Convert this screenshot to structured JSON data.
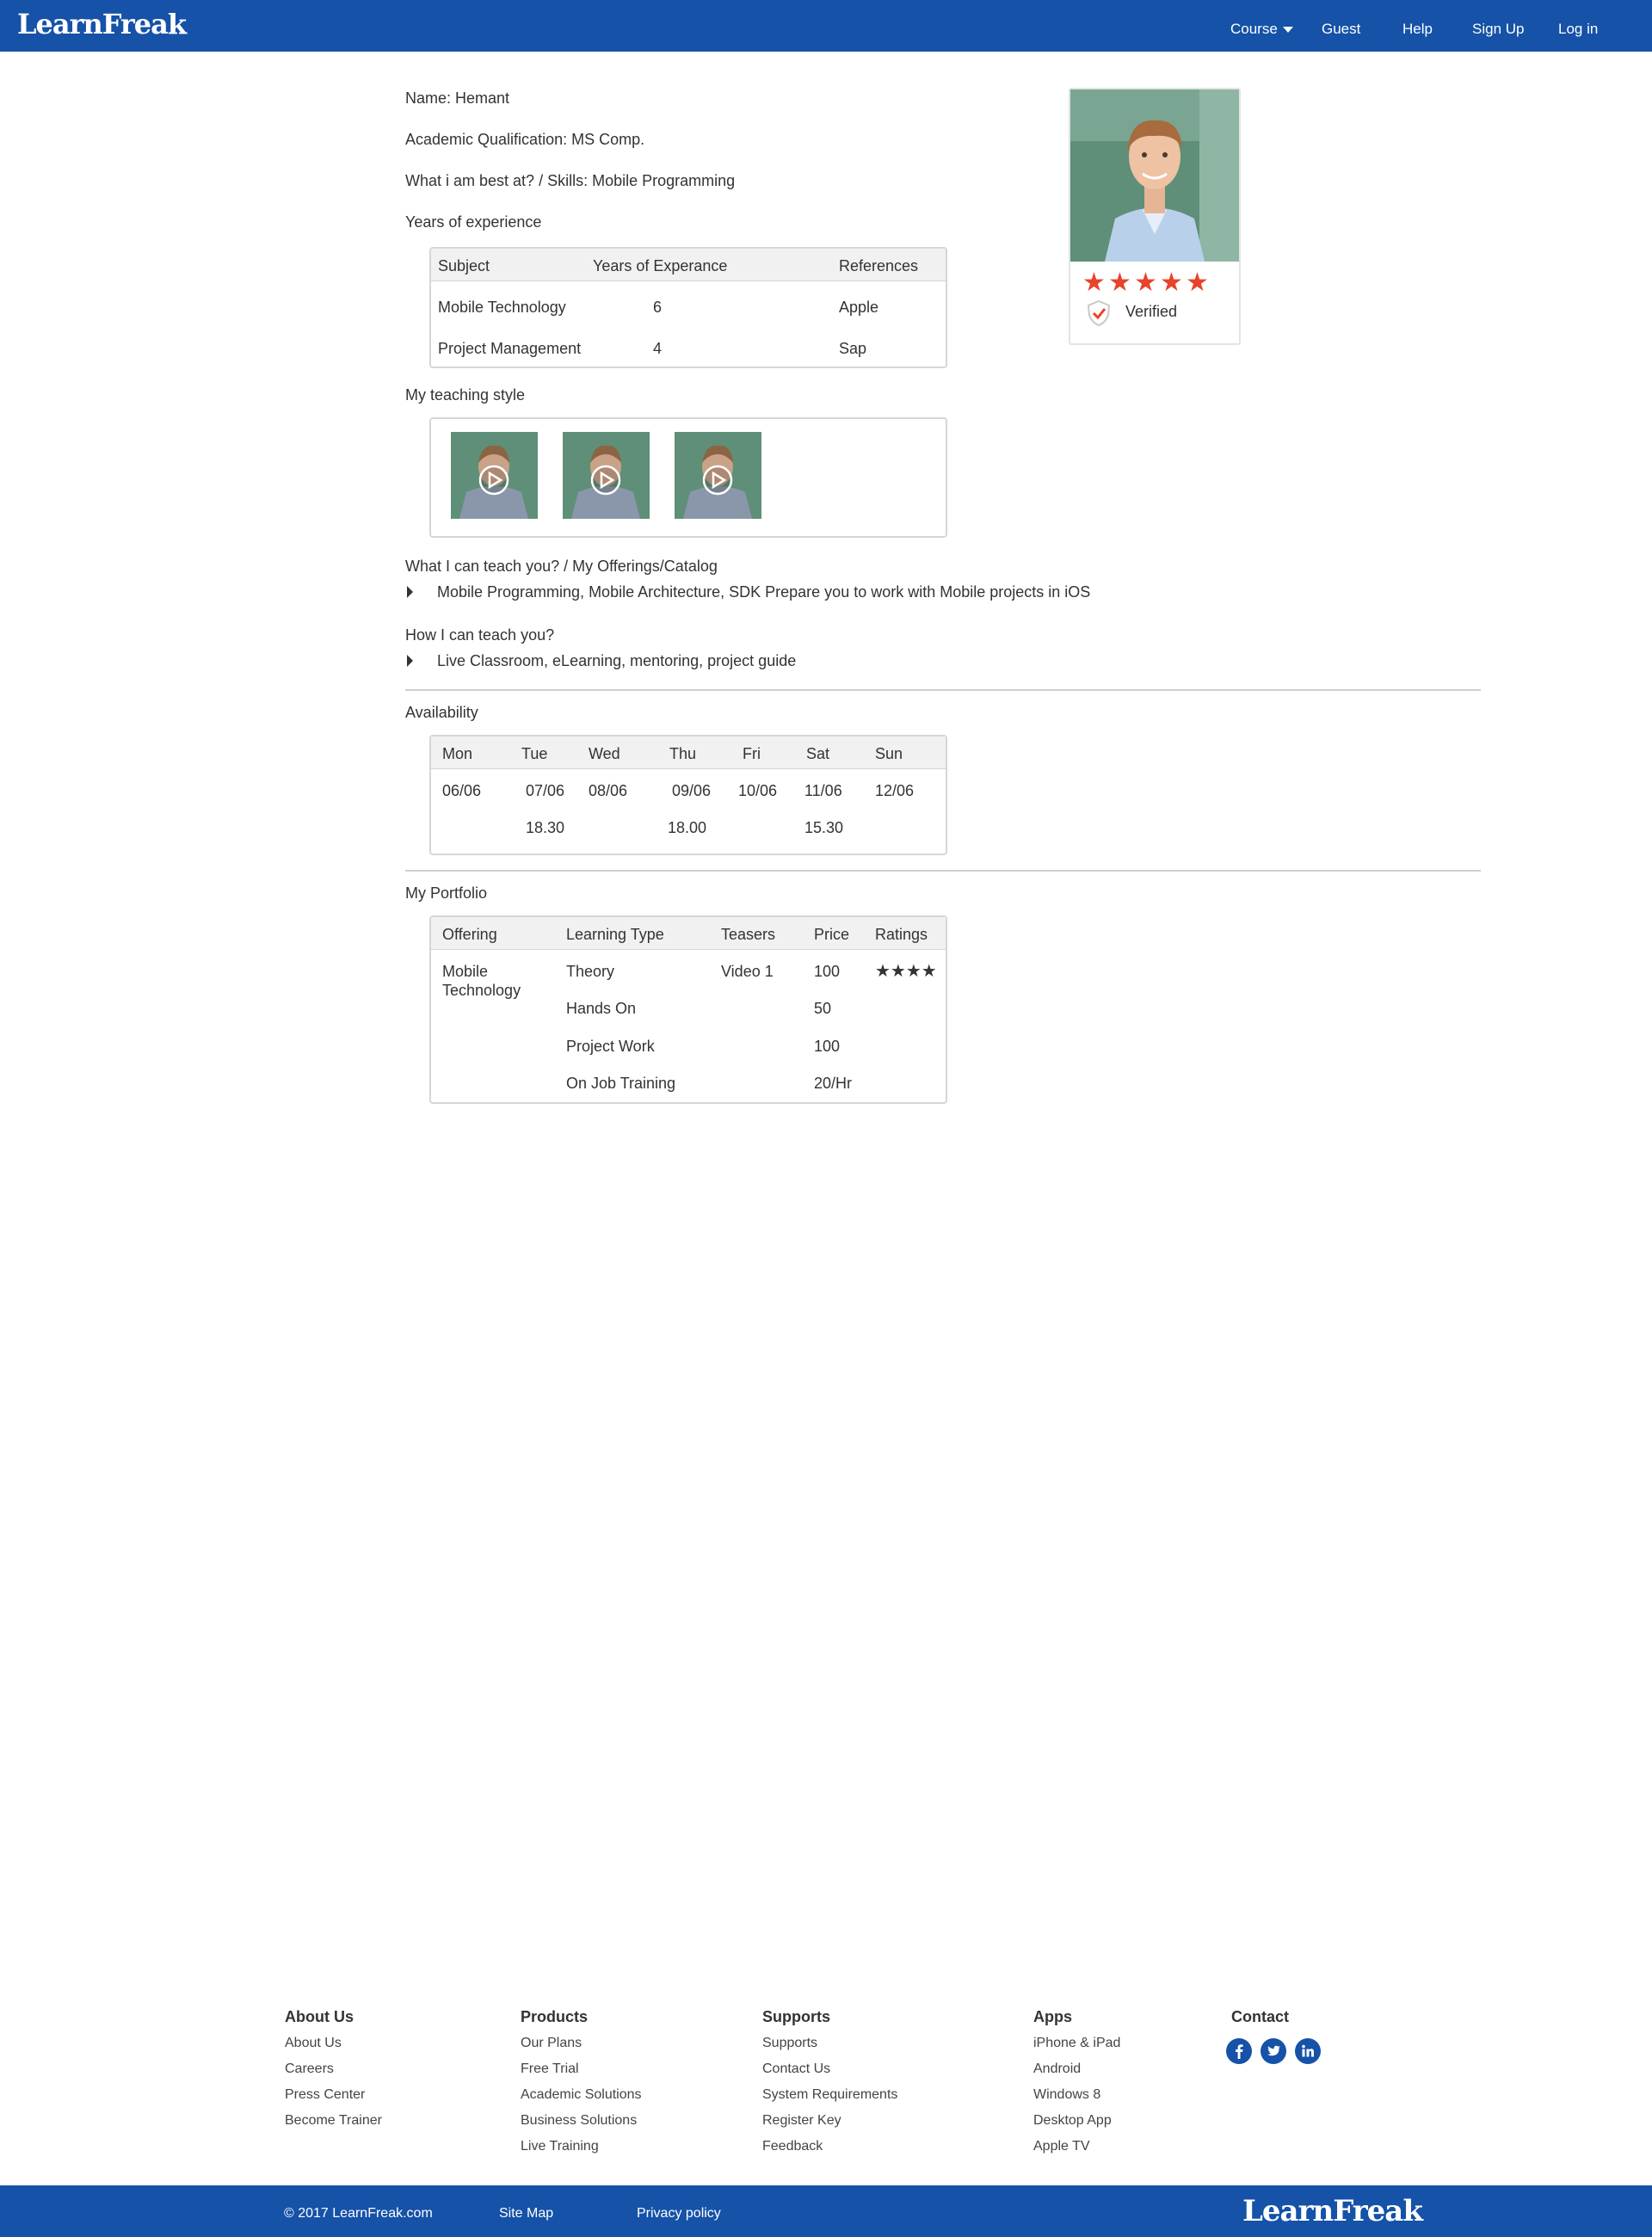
{
  "header": {
    "logo": "LearnFreak",
    "nav": {
      "course": "Course",
      "guest": "Guest",
      "help": "Help",
      "signup": "Sign Up",
      "login": "Log in"
    }
  },
  "profile": {
    "name": "Name: Hemant",
    "qualification": "Academic Qualification: MS Comp.",
    "skills": "What i am best at? / Skills: Mobile Programming",
    "experience_title": "Years of experience",
    "rating_stars": 5,
    "verified": "Verified"
  },
  "experience_table": {
    "headers": [
      "Subject",
      "Years of Experance",
      "References"
    ],
    "rows": [
      [
        "Mobile Technology",
        "6",
        "Apple"
      ],
      [
        "Project Management",
        "4",
        "Sap"
      ]
    ]
  },
  "teaching_style": {
    "title": "My teaching style",
    "videos": [
      "video-1",
      "video-2",
      "video-3"
    ]
  },
  "offerings": {
    "title": "What I can teach you? / My Offerings/Catalog",
    "item": "Mobile Programming, Mobile Architecture, SDK Prepare you to work with Mobile projects in iOS"
  },
  "how_teach": {
    "title": "How I can teach you?",
    "item": "Live Classroom, eLearning, mentoring, project guide"
  },
  "availability": {
    "title": "Availability",
    "days": [
      "Mon",
      "Tue",
      "Wed",
      "Thu",
      "Fri",
      "Sat",
      "Sun"
    ],
    "dates": [
      "06/06",
      "07/06",
      "08/06",
      "09/06",
      "10/06",
      "11/06",
      "12/06"
    ],
    "times": [
      "",
      "18.30",
      "",
      "18.00",
      "",
      "15.30",
      ""
    ]
  },
  "portfolio": {
    "title": "My Portfolio",
    "headers": [
      "Offering",
      "Learning Type",
      "Teasers",
      "Price",
      "Ratings"
    ],
    "offering_line1": "Mobile",
    "offering_line2": "Technology",
    "rows": [
      {
        "type": "Theory",
        "teaser": "Video 1",
        "price": "100",
        "rating": "★★★★"
      },
      {
        "type": "Hands On",
        "teaser": "",
        "price": "50",
        "rating": ""
      },
      {
        "type": "Project Work",
        "teaser": "",
        "price": "100",
        "rating": ""
      },
      {
        "type": "On Job Training",
        "teaser": "",
        "price": "20/Hr",
        "rating": ""
      }
    ]
  },
  "footer": {
    "columns": [
      {
        "title": "About Us",
        "links": [
          "About Us",
          "Careers",
          "Press Center",
          "Become Trainer"
        ]
      },
      {
        "title": "Products",
        "links": [
          "Our Plans",
          "Free Trial",
          "Academic Solutions",
          "Business Solutions",
          "Live Training"
        ]
      },
      {
        "title": "Supports",
        "links": [
          "Supports",
          "Contact Us",
          "System Requirements",
          "Register Key",
          "Feedback"
        ]
      },
      {
        "title": "Apps",
        "links": [
          "iPhone & iPad",
          "Android",
          "Windows 8",
          "Desktop App",
          "Apple TV"
        ]
      }
    ],
    "contact_title": "Contact",
    "social": [
      "facebook-icon",
      "twitter-icon",
      "linkedin-icon"
    ],
    "copyright": "© 2017 LearnFreak.com",
    "sitemap": "Site Map",
    "privacy": "Privacy policy",
    "logo": "LearnFreak"
  },
  "colors": {
    "brand_blue": "#1552a8",
    "star_red": "#e8432b"
  }
}
